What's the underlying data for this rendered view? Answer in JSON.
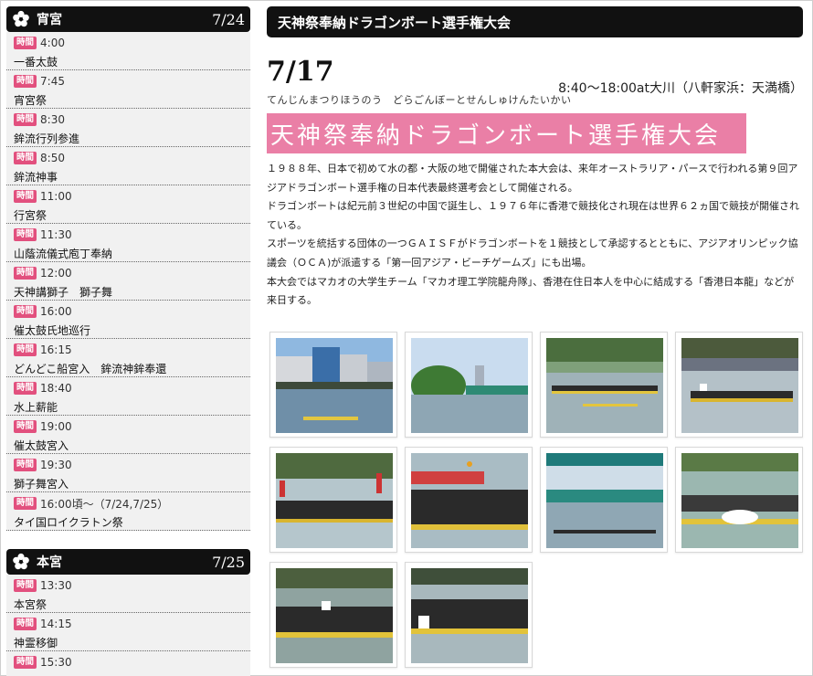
{
  "sidebar": {
    "section1": {
      "icon": "flower-icon",
      "title": "宵宮",
      "date": "7/24",
      "items": [
        {
          "tag": "時間",
          "time": "4:00",
          "event": "一番太鼓"
        },
        {
          "tag": "時間",
          "time": "7:45",
          "event": "宵宮祭"
        },
        {
          "tag": "時間",
          "time": "8:30",
          "event": "鉾流行列参進"
        },
        {
          "tag": "時間",
          "time": "8:50",
          "event": "鉾流神事"
        },
        {
          "tag": "時間",
          "time": "11:00",
          "event": "行宮祭"
        },
        {
          "tag": "時間",
          "time": "11:30",
          "event": "山蔭流儀式庖丁奉納"
        },
        {
          "tag": "時間",
          "time": "12:00",
          "event": "天神講獅子　獅子舞"
        },
        {
          "tag": "時間",
          "time": "16:00",
          "event": "催太鼓氏地巡行"
        },
        {
          "tag": "時間",
          "time": "16:15",
          "event": "どんどこ船宮入　鉾流神鉾奉還"
        },
        {
          "tag": "時間",
          "time": "18:40",
          "event": "水上薪能"
        },
        {
          "tag": "時間",
          "time": "19:00",
          "event": "催太鼓宮入"
        },
        {
          "tag": "時間",
          "time": "19:30",
          "event": "獅子舞宮入"
        },
        {
          "tag": "時間",
          "time": "16:00頃～（7/24,7/25）",
          "event": "タイ国ロイクラトン祭"
        }
      ]
    },
    "section2": {
      "icon": "flower-icon",
      "title": "本宮",
      "date": "7/25",
      "items": [
        {
          "tag": "時間",
          "time": "13:30",
          "event": "本宮祭"
        },
        {
          "tag": "時間",
          "time": "14:15",
          "event": "神霊移御"
        },
        {
          "tag": "時間",
          "time": "15:30",
          "event": ""
        }
      ]
    }
  },
  "main": {
    "header": "天神祭奉納ドラゴンボート選手権大会",
    "date": "7/17",
    "time_place": "8:40～18:00at大川（八軒家浜：天満橋）",
    "kana": "てんじんまつりほうのう　どらごんぼーとせんしゅけんたいかい",
    "banner": "天神祭奉納ドラゴンボート選手権大会",
    "paragraphs": [
      "１９８８年、日本で初めて水の都・大阪の地で開催された本大会は、来年オーストラリア・パースで行われる第９回アジアドラゴンボート選手権の日本代表最終選考会として開催される。",
      "ドラゴンボートは紀元前３世紀の中国で誕生し、１９７６年に香港で競技化され現在は世界６２ヵ国で競技が開催されている。",
      "スポーツを統括する団体の一つＧＡＩＳＦがドラゴンボートを１競技として承認するとともに、アジアオリンピック協議会（ＯＣＡ)が派遣する「第一回アジア・ビーチゲームズ」にも出場。",
      "本大会ではマカオの大学生チーム「マカオ理工学院龍舟隊」、香港在住日本人を中心に結成する「香港日本龍」などが来日する。"
    ]
  },
  "gallery": {
    "photos": [
      {
        "name": "photo-river-buildings"
      },
      {
        "name": "photo-river-trees"
      },
      {
        "name": "photo-boats-race"
      },
      {
        "name": "photo-boat-2"
      },
      {
        "name": "photo-team-flags"
      },
      {
        "name": "photo-rowers-closeup"
      },
      {
        "name": "photo-bridge-race"
      },
      {
        "name": "photo-boat-splash"
      },
      {
        "name": "photo-boat-4"
      },
      {
        "name": "photo-boat-1"
      }
    ]
  }
}
